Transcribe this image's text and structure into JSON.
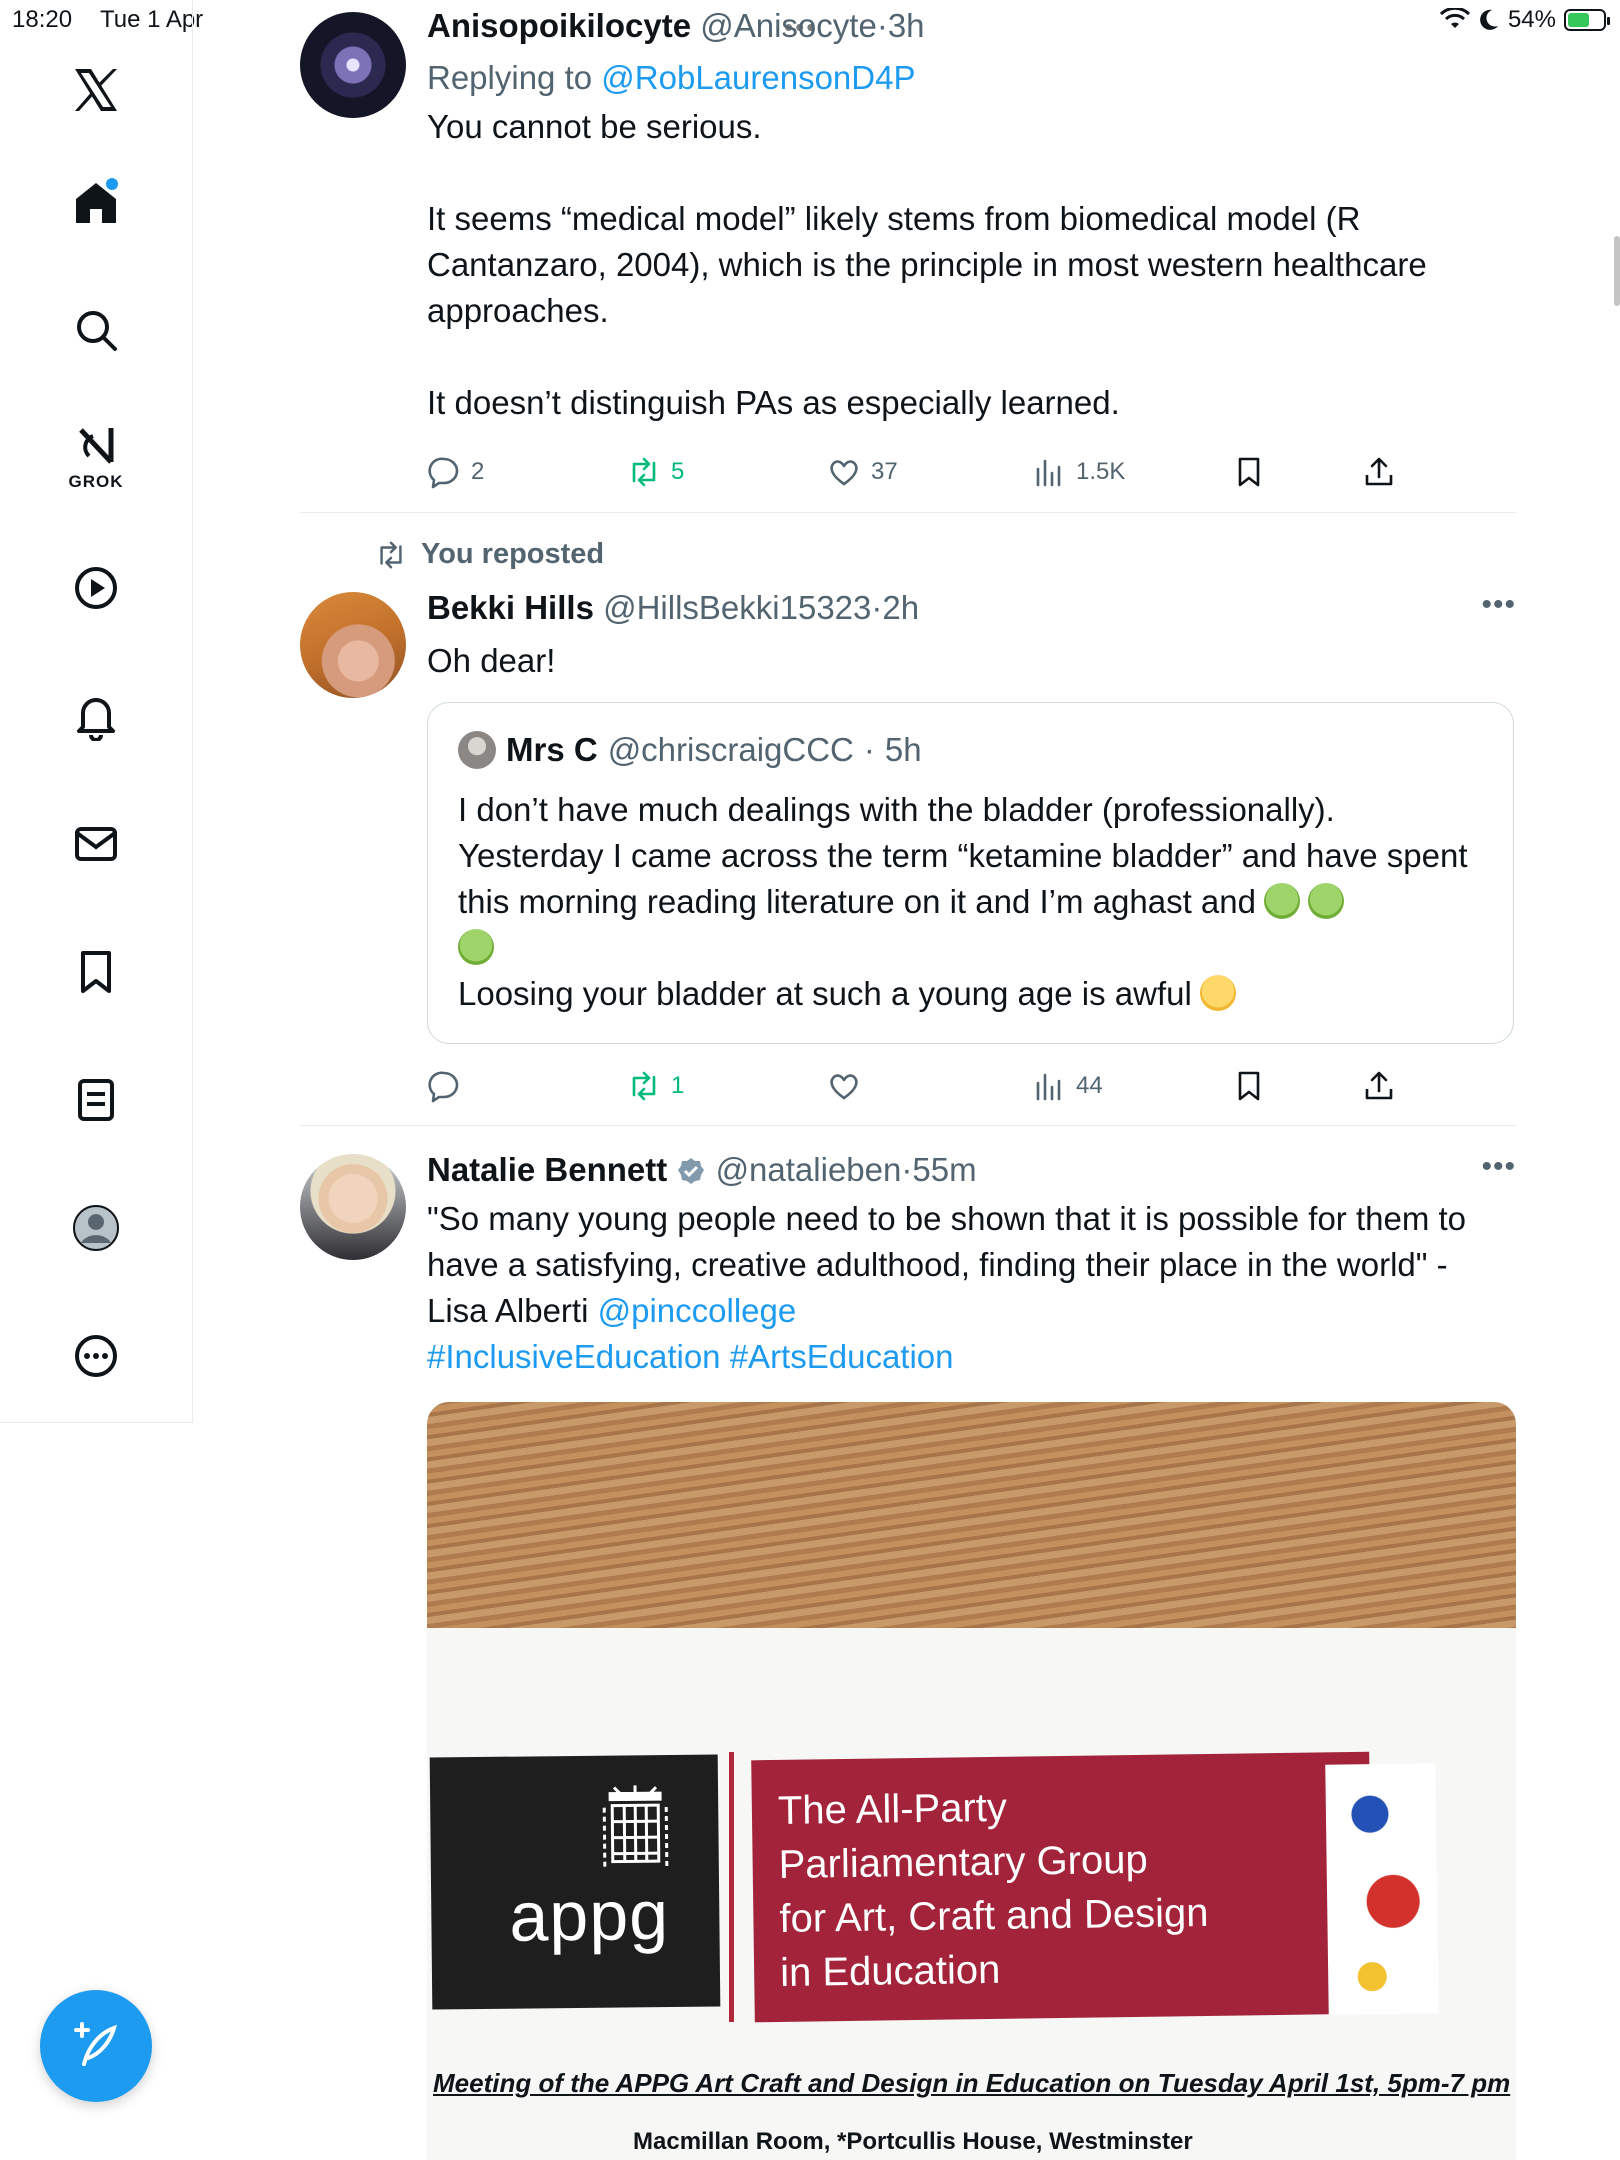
{
  "status_bar": {
    "time": "18:20",
    "date": "Tue 1 Apr",
    "battery": "54%",
    "battery_level": 0.54
  },
  "sidebar": {
    "items": [
      {
        "name": "x-logo-icon"
      },
      {
        "name": "home-icon",
        "has_notification": true
      },
      {
        "name": "search-icon"
      },
      {
        "name": "grok-icon",
        "label": "GROK"
      },
      {
        "name": "play-icon"
      },
      {
        "name": "notifications-icon"
      },
      {
        "name": "messages-icon"
      },
      {
        "name": "bookmarks-icon"
      },
      {
        "name": "lists-icon"
      },
      {
        "name": "profile-icon"
      },
      {
        "name": "more-icon"
      }
    ],
    "compose_icon": "compose-icon"
  },
  "tweets": [
    {
      "name": "Anisopoikilocyte",
      "handle": "@Anisocyte",
      "dot": "·",
      "time": "3h",
      "replying_prefix": "Replying to",
      "replying_to": "@RobLaurensonD4P",
      "paragraphs": [
        "You cannot be serious.",
        "It seems “medical model” likely stems from biomedical model (R Cantanzaro, 2004), which is the principle in most western healthcare approaches.",
        "It doesn’t distinguish PAs as especially learned."
      ],
      "replies": "2",
      "reposts": "5",
      "likes": "37",
      "views": "1.5K"
    },
    {
      "repost_label": "You reposted",
      "name": "Bekki Hills",
      "handle": "@HillsBekki15323",
      "dot": "·",
      "time": "2h",
      "text": "Oh dear!",
      "quote": {
        "name": "Mrs C",
        "handle": "@chriscraigCCC",
        "dot": "·",
        "time": "5h",
        "line1": "I don’t have much dealings with the bladder (professionally).",
        "line2": "Yesterday I came across the term “ketamine bladder” and have spent this morning reading literature on it and I’m aghast and",
        "line3": "Loosing your bladder at such a young age is awful"
      },
      "reposts": "1",
      "views": "44"
    },
    {
      "name": "Natalie Bennett",
      "handle": "@natalieben",
      "dot": "·",
      "time": "55m",
      "text": "\"So many young people need to be shown that it is possible for them to have a satisfying, creative adulthood, finding their place in the world\" - Lisa Alberti",
      "mention": "@pinccollege",
      "hashtag1": "#InclusiveEducation",
      "hashtag2": "#ArtsEducation",
      "image": {
        "appg": "appg",
        "red_lines": [
          "The All-Party",
          "Parliamentary Group",
          "for Art, Craft and Design",
          "in Education"
        ],
        "meeting": "Meeting of the APPG Art Craft and Design in Education on Tuesday April 1st, 5pm-7 pm",
        "location": "Macmillan Room, *Portcullis House, Westminster"
      }
    }
  ]
}
